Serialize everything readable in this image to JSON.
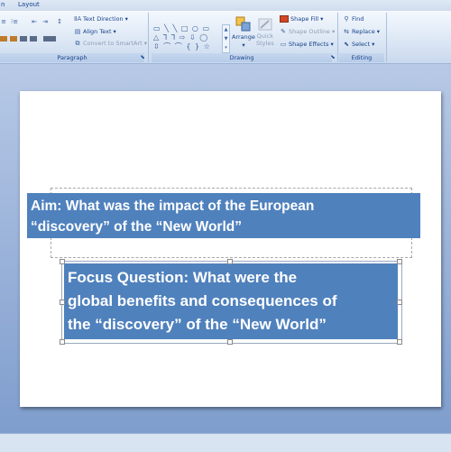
{
  "tabs": [
    "n",
    "Layout"
  ],
  "ribbon": {
    "paragraph": {
      "label": "Paragraph",
      "text_direction": "Text Direction",
      "align_text": "Align Text",
      "convert_smartart": "Convert to SmartArt"
    },
    "drawing": {
      "label": "Drawing",
      "arrange": "Arrange",
      "quick_styles_1": "Quick",
      "quick_styles_2": "Styles",
      "shape_fill": "Shape Fill",
      "shape_outline": "Shape Outline",
      "shape_effects": "Shape Effects",
      "shapes_row1": "▭ ╲ ╲ □ ○ ▭",
      "shapes_row2": "△ ⅂ ⅂ ⇨ ⇩ ◯",
      "shapes_row3": "⇳ ⌒ ⌒ { } ☆"
    },
    "editing": {
      "label": "Editing",
      "find": "Find",
      "replace": "Replace",
      "select": "Select"
    },
    "colors": {
      "shape_fill": "#d24726"
    }
  },
  "slide": {
    "aim_line1": "Aim:  What was the impact of the European",
    "aim_line2": "“discovery” of the “New World”",
    "focus_line1": "Focus Question:  What were the",
    "focus_line2": "global benefits and consequences of",
    "focus_line3": "the “discovery” of the “New World”",
    "box_color": "#4f81bd"
  }
}
